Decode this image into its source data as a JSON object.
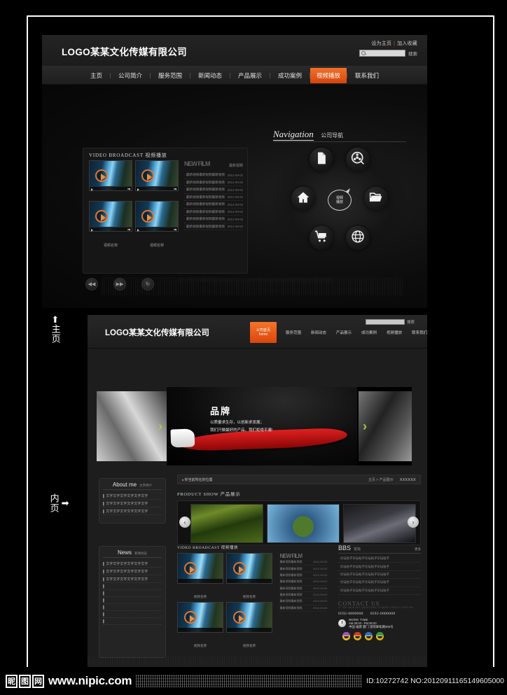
{
  "frame": {
    "accent": "#e8732a"
  },
  "home_mock": {
    "logo": "LOGO某某文化传媒有限公司",
    "utility": {
      "set_home": "设为主页",
      "separator": "|",
      "add_fav": "加入收藏"
    },
    "search": {
      "placeholder": "",
      "button_label": "搜索"
    },
    "nav": [
      {
        "label": "主页",
        "active": false
      },
      {
        "label": "公司简介",
        "active": false
      },
      {
        "label": "服务范围",
        "active": false
      },
      {
        "label": "新闻动态",
        "active": false
      },
      {
        "label": "产品展示",
        "active": false
      },
      {
        "label": "成功案例",
        "active": false
      },
      {
        "label": "视频播放",
        "active": true
      },
      {
        "label": "联系我们",
        "active": false
      }
    ],
    "video_panel": {
      "title": "VIDEO  BROADCAST 视频播放",
      "thumbs": [
        {
          "caption": "视频名称",
          "duration": "00:00/04:16"
        },
        {
          "caption": "视频名称",
          "duration": "00:00/04:16"
        },
        {
          "caption": "视频名称",
          "duration": "00:00/04:16"
        },
        {
          "caption": "视频名称",
          "duration": "00:00/04:16"
        }
      ],
      "list_header": {
        "en": "NEW FILM",
        "cn": "最新视频"
      },
      "list": [
        {
          "title": "最新视频最新视频最新视频",
          "date": "2012-09-02"
        },
        {
          "title": "最新视频最新视频最新视频",
          "date": "2012-09-02"
        },
        {
          "title": "最新视频最新视频最新视频",
          "date": "2012-09-02"
        },
        {
          "title": "最新视频最新视频最新视频",
          "date": "2012-09-02"
        },
        {
          "title": "最新视频最新视频最新视频",
          "date": "2012-09-02"
        },
        {
          "title": "最新视频最新视频最新视频",
          "date": "2012-09-02"
        },
        {
          "title": "最新视频最新视频最新视频",
          "date": "2012-09-02"
        },
        {
          "title": "最新视频最新视频最新视频",
          "date": "2012-09-02"
        }
      ],
      "controls": [
        {
          "name": "prev",
          "glyph": "◀◀"
        },
        {
          "name": "next",
          "glyph": "▶▶"
        },
        {
          "name": "replay",
          "glyph": "↻"
        }
      ]
    },
    "navigation_panel": {
      "title_en": "Navigation",
      "title_cn": "公司导航",
      "nodes": [
        {
          "icon": "document-icon",
          "label": ""
        },
        {
          "icon": "film-reel-icon",
          "label": ""
        },
        {
          "icon": "home-icon",
          "label": ""
        },
        {
          "icon": "video-bubble-icon",
          "label_line1": "视频",
          "label_line2": "播放"
        },
        {
          "icon": "folder-icon",
          "label": ""
        },
        {
          "icon": "shopping-cart-icon",
          "label": ""
        },
        {
          "icon": "globe-icon",
          "label": ""
        }
      ]
    }
  },
  "markers": {
    "home": {
      "arrow": "⬆",
      "label": "主页"
    },
    "inner": {
      "arrow": "➡",
      "label": "内页"
    }
  },
  "inner_mock": {
    "logo": "LOGO某某文化传媒有限公司",
    "search": {
      "button_label": "搜索"
    },
    "nav_home": {
      "line1": "公司首页",
      "line2": "home"
    },
    "nav": [
      "服务范围",
      "新闻动态",
      "产品展示",
      "成功案例",
      "视频播放",
      "联系我们"
    ],
    "banner": {
      "headline": "品牌",
      "line1": "以质量求生存，以创新求发展；",
      "line2": "我们只做最好的产品，我们拒绝平庸!",
      "prev_chevron": "›",
      "next_chevron": "›"
    },
    "breadcrumb": {
      "label": "你当前所在的位置",
      "path": "主页 > 产品展示",
      "current": "XXXXXX"
    },
    "product_show": {
      "heading": "PRODUCT SHOW  产品展示",
      "prev": "‹",
      "next": "›",
      "items": [
        {
          "alt": "beer-bottle-photo"
        },
        {
          "alt": "tiny-planet-photo"
        },
        {
          "alt": "sports-car-photo"
        }
      ]
    },
    "sidebar": {
      "about": {
        "title_en": "About me",
        "title_cn": "文字简介",
        "items": [
          "文字文字文字文字文字文字",
          "文字文字文字文字文字文字",
          "文字文字文字文字文字文字"
        ]
      },
      "news": {
        "title_en": "News",
        "title_cn": "新闻动态",
        "items": [
          "文字文字文字文字文字文字",
          "文字文字文字文字文字文字",
          "文字文字文字文字文字文字",
          "",
          "",
          "",
          "",
          "",
          ""
        ]
      }
    },
    "video_broadcast": {
      "heading": "VIDEO  BROADCAST 视频播放",
      "thumbs": [
        {
          "caption": "视频名称"
        },
        {
          "caption": "视频名称"
        },
        {
          "caption": "视频名称"
        },
        {
          "caption": "视频名称"
        }
      ],
      "list_header": "NEW FILM",
      "list": [
        {
          "title": "最新视频最新视频",
          "date": "2012-09-02"
        },
        {
          "title": "最新视频最新视频",
          "date": "2012-09-02"
        },
        {
          "title": "最新视频最新视频",
          "date": "2012-09-02"
        },
        {
          "title": "最新视频最新视频",
          "date": "2012-09-02"
        },
        {
          "title": "最新视频最新视频",
          "date": "2012-09-02"
        },
        {
          "title": "最新视频最新视频",
          "date": "2012-09-02"
        },
        {
          "title": "最新视频最新视频",
          "date": "2012-09-02"
        },
        {
          "title": "最新视频最新视频",
          "date": "2012-09-02"
        }
      ]
    },
    "bbs": {
      "title_en": "BBS",
      "title_cn": "论坛",
      "more": "更多",
      "items": [
        "论坛帖子论坛帖子论坛帖子论坛帖子",
        "论坛帖子论坛帖子论坛帖子论坛帖子",
        "论坛帖子论坛帖子论坛帖子论坛帖子",
        "论坛帖子论坛帖子论坛帖子论坛帖子",
        "论坛帖子论坛帖子论坛帖子论坛帖子"
      ]
    },
    "contact": {
      "title": "CONTACT US",
      "subtitle": "IF YOU HAVE ANY QUESTIONS, PLEASE CONTACT WITH US",
      "phone1": "0592-0000000",
      "phone2": "0592-0000000",
      "worktime_label": "WORK TIME",
      "worktime_value": "AM.09:00 - PM.06:00",
      "address": "中国 福建 厦门 思明翠松路000号",
      "qq_icons": [
        "qq-purple-icon",
        "qq-red-icon",
        "qq-blue-icon",
        "qq-green-icon"
      ]
    }
  },
  "watermark": {
    "brand_chars": [
      "昵",
      "图",
      "网"
    ],
    "url": "www.nipic.com",
    "id_line": "ID:10272742 NO:20120911165149605000"
  }
}
